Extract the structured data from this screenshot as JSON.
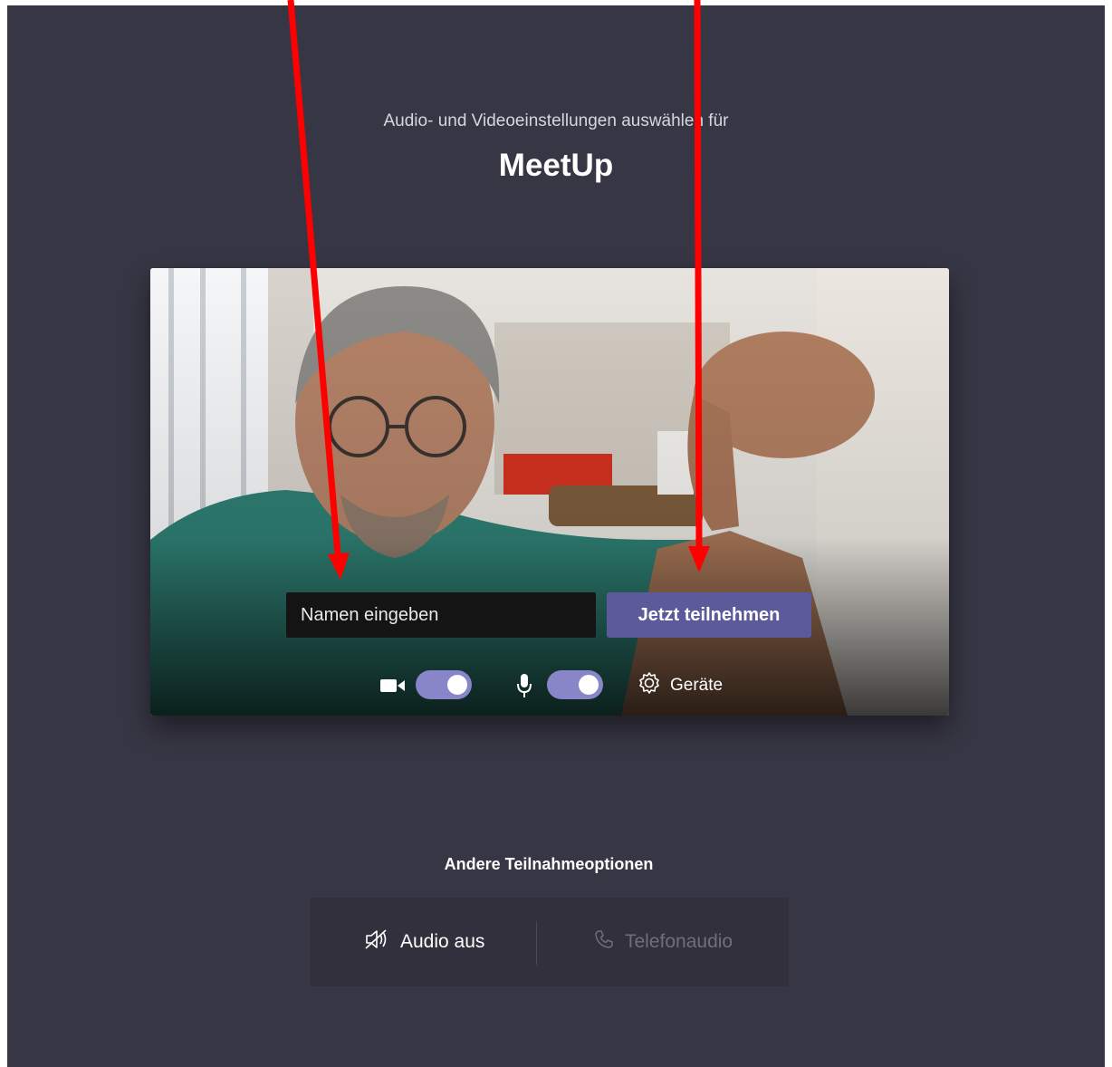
{
  "header": {
    "subtitle": "Audio- und Videoeinstellungen auswählen für",
    "meeting_name": "MeetUp"
  },
  "preview": {
    "name_placeholder": "Namen eingeben",
    "name_value": "",
    "join_label": "Jetzt teilnehmen",
    "camera_toggle_on": true,
    "mic_toggle_on": true,
    "devices_label": "Geräte"
  },
  "other_options": {
    "title": "Andere Teilnahmeoptionen",
    "audio_off_label": "Audio aus",
    "phone_audio_label": "Telefonaudio"
  },
  "colors": {
    "background": "#373644",
    "accent": "#5b5a9a",
    "toggle": "#8886c8",
    "annotation_arrow": "#ff0000"
  },
  "icons": [
    "video-camera-icon",
    "microphone-icon",
    "gear-icon",
    "speaker-off-icon",
    "phone-icon"
  ]
}
